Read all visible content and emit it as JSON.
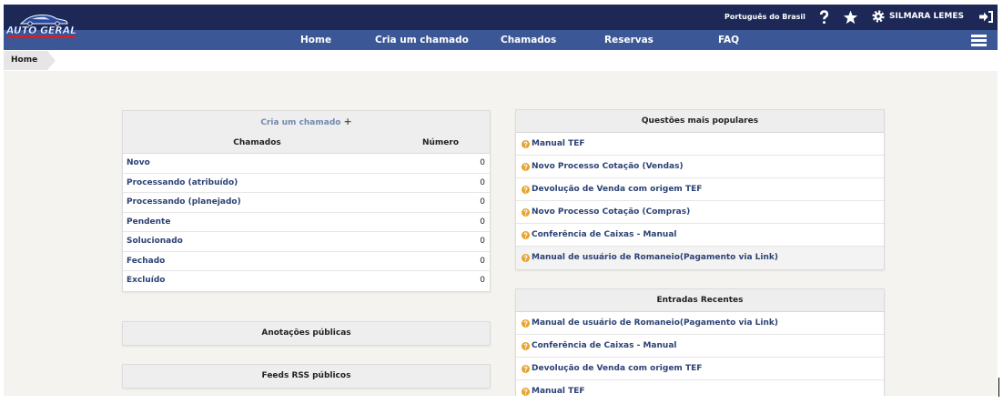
{
  "header": {
    "logo_text": "AUTO GERAL",
    "language": "Português do Brasil",
    "user_name": "SILMARA LEMES",
    "icons": [
      "help-icon",
      "star-icon",
      "gear-icon",
      "logout-icon",
      "hamburger-menu-icon"
    ]
  },
  "menu": {
    "items": [
      {
        "label": "Home"
      },
      {
        "label": "Cria um chamado"
      },
      {
        "label": "Chamados"
      },
      {
        "label": "Reservas"
      },
      {
        "label": "FAQ"
      }
    ]
  },
  "breadcrumb": {
    "items": [
      {
        "label": "Home"
      }
    ]
  },
  "tickets_panel": {
    "create_link": "Cria um chamado",
    "create_symbol": "+",
    "columns": [
      "Chamados",
      "Número"
    ],
    "rows": [
      {
        "label": "Novo",
        "count": "0"
      },
      {
        "label": "Processando (atribuído)",
        "count": "0"
      },
      {
        "label": "Processando (planejado)",
        "count": "0"
      },
      {
        "label": "Pendente",
        "count": "0"
      },
      {
        "label": "Solucionado",
        "count": "0"
      },
      {
        "label": "Fechado",
        "count": "0"
      },
      {
        "label": "Excluído",
        "count": "0"
      }
    ]
  },
  "public_notes": {
    "title": "Anotações públicas"
  },
  "public_rss": {
    "title": "Feeds RSS públicos"
  },
  "popular_questions": {
    "title": "Questões mais populares",
    "item_icon": "question-circle-icon",
    "items": [
      {
        "label": "Manual TEF"
      },
      {
        "label": "Novo Processo Cotação (Vendas)"
      },
      {
        "label": "Devolução de Venda com origem TEF"
      },
      {
        "label": "Novo Processo Cotação (Compras)"
      },
      {
        "label": "Conferência de Caixas - Manual"
      },
      {
        "label": "Manual de usuário de Romaneio(Pagamento via Link)"
      }
    ]
  },
  "recent_entries": {
    "title": "Entradas Recentes",
    "item_icon": "question-circle-icon",
    "items": [
      {
        "label": "Manual de usuário de Romaneio(Pagamento via Link)"
      },
      {
        "label": "Conferência de Caixas - Manual"
      },
      {
        "label": "Devolução de Venda com origem TEF"
      },
      {
        "label": "Manual TEF"
      }
    ]
  },
  "colors": {
    "top_bar": "#1d2857",
    "menu_bar": "#3b5795",
    "content_bg": "#f4f3ef",
    "link": "#2c4275",
    "muted_link": "#7488b0",
    "faq_icon": "#e8a32e",
    "panel_head": "#eeeeee"
  }
}
